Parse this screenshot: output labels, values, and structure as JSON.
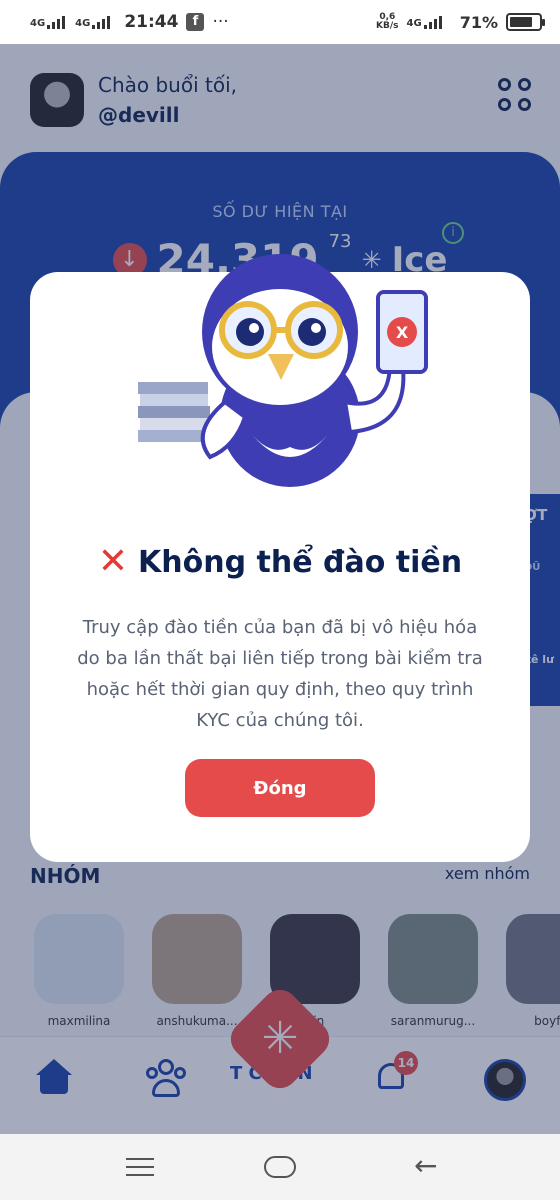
{
  "status_bar": {
    "network1": "4G",
    "network2": "4G",
    "time": "21:44",
    "more": "···",
    "speed_value": "0,6",
    "speed_unit": "KB/s",
    "network3": "4G",
    "battery": "71%"
  },
  "header": {
    "greeting": "Chào buổi tối,",
    "username": "@devill"
  },
  "balance": {
    "label": "SỐ DƯ HIỆN TẠI",
    "value": "24,319",
    "decimals": "73",
    "currency": "Ice"
  },
  "side_card": {
    "title": "ỢT",
    "line2": "DŨ",
    "line3": "kê lư"
  },
  "groups": {
    "title": "NHÓM",
    "link": "xem nhóm",
    "members": [
      {
        "name": "maxmilina"
      },
      {
        "name": "anshukuma..."
      },
      {
        "name": "hin"
      },
      {
        "name": "saranmurug..."
      },
      {
        "name": "boyfe"
      }
    ]
  },
  "tabbar": {
    "chain_label": "T CHAIN",
    "notification_count": "14"
  },
  "modal": {
    "title": "Không thể đào tiền",
    "body": "Truy cập đào tiền của bạn đã bị vô hiệu hóa do ba lần thất bại liên tiếp trong bài kiểm tra hoặc hết thời gian quy định, theo quy trình KYC của chúng tôi.",
    "button_label": "Đóng"
  },
  "colors": {
    "brand_blue": "#1741a8",
    "accent_red": "#e54b4b",
    "title_navy": "#0d2150"
  }
}
